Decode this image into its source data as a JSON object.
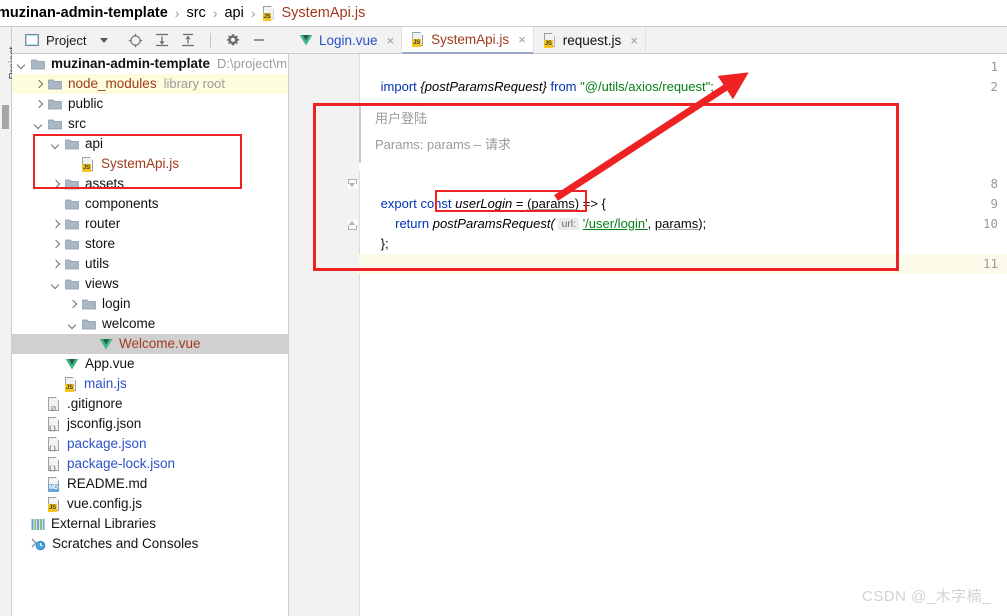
{
  "breadcrumb": {
    "segments": [
      {
        "text": "muzinan-admin-template",
        "kind": "root"
      },
      {
        "text": "src",
        "kind": "dir"
      },
      {
        "text": "api",
        "kind": "dir"
      },
      {
        "text": "SystemApi.js",
        "kind": "file-js"
      }
    ],
    "separator": "›"
  },
  "left_strip": {
    "vertical_tab_label": "Project"
  },
  "project_toolbar": {
    "title": "Project",
    "dropdown_caret": "chevron-down",
    "icons": [
      "locate-target-icon",
      "expand-all-icon",
      "collapse-all-icon",
      "settings-gear-icon",
      "hide-panel-icon"
    ]
  },
  "tree": {
    "items": [
      {
        "id": "root",
        "label": "muzinan-admin-template",
        "sub": "D:\\project\\m",
        "indent": 0,
        "arrow": "down",
        "icon": "folder-icon",
        "bold": true,
        "color": "dark",
        "highlight": false,
        "selected": false
      },
      {
        "id": "node_modules",
        "label": "node_modules",
        "sub": "library root",
        "indent": 1,
        "arrow": "right",
        "icon": "folder-icon",
        "bold": false,
        "color": "orange",
        "highlight": true,
        "selected": false
      },
      {
        "id": "public",
        "label": "public",
        "sub": "",
        "indent": 1,
        "arrow": "right",
        "icon": "folder-icon",
        "bold": false,
        "color": "dark",
        "highlight": false,
        "selected": false
      },
      {
        "id": "src",
        "label": "src",
        "sub": "",
        "indent": 1,
        "arrow": "down",
        "icon": "folder-icon",
        "bold": false,
        "color": "dark",
        "highlight": false,
        "selected": false
      },
      {
        "id": "api",
        "label": "api",
        "sub": "",
        "indent": 2,
        "arrow": "down",
        "icon": "folder-icon",
        "bold": false,
        "color": "dark",
        "highlight": false,
        "selected": false
      },
      {
        "id": "systemapi",
        "label": "SystemApi.js",
        "sub": "",
        "indent": 3,
        "arrow": "none",
        "icon": "js-file-icon",
        "bold": false,
        "color": "orange",
        "highlight": false,
        "selected": false
      },
      {
        "id": "assets",
        "label": "assets",
        "sub": "",
        "indent": 2,
        "arrow": "right",
        "icon": "folder-icon",
        "bold": false,
        "color": "dark",
        "highlight": false,
        "selected": false
      },
      {
        "id": "components",
        "label": "components",
        "sub": "",
        "indent": 2,
        "arrow": "none",
        "icon": "folder-icon",
        "bold": false,
        "color": "dark",
        "highlight": false,
        "selected": false
      },
      {
        "id": "router",
        "label": "router",
        "sub": "",
        "indent": 2,
        "arrow": "right",
        "icon": "folder-icon",
        "bold": false,
        "color": "dark",
        "highlight": false,
        "selected": false
      },
      {
        "id": "store",
        "label": "store",
        "sub": "",
        "indent": 2,
        "arrow": "right",
        "icon": "folder-icon",
        "bold": false,
        "color": "dark",
        "highlight": false,
        "selected": false
      },
      {
        "id": "utils",
        "label": "utils",
        "sub": "",
        "indent": 2,
        "arrow": "right",
        "icon": "folder-icon",
        "bold": false,
        "color": "dark",
        "highlight": false,
        "selected": false
      },
      {
        "id": "views",
        "label": "views",
        "sub": "",
        "indent": 2,
        "arrow": "down",
        "icon": "folder-icon",
        "bold": false,
        "color": "dark",
        "highlight": false,
        "selected": false
      },
      {
        "id": "login",
        "label": "login",
        "sub": "",
        "indent": 3,
        "arrow": "right",
        "icon": "folder-icon",
        "bold": false,
        "color": "dark",
        "highlight": false,
        "selected": false
      },
      {
        "id": "welcome",
        "label": "welcome",
        "sub": "",
        "indent": 3,
        "arrow": "down",
        "icon": "folder-icon",
        "bold": false,
        "color": "dark",
        "highlight": false,
        "selected": false
      },
      {
        "id": "welcomevue",
        "label": "Welcome.vue",
        "sub": "",
        "indent": 4,
        "arrow": "none",
        "icon": "vue-file-icon",
        "bold": false,
        "color": "orange",
        "highlight": false,
        "selected": true
      },
      {
        "id": "appvue",
        "label": "App.vue",
        "sub": "",
        "indent": 2,
        "arrow": "none",
        "icon": "vue-file-icon",
        "bold": false,
        "color": "dark",
        "highlight": false,
        "selected": false
      },
      {
        "id": "mainjs",
        "label": "main.js",
        "sub": "",
        "indent": 2,
        "arrow": "none",
        "icon": "js-file-icon",
        "bold": false,
        "color": "blue",
        "highlight": false,
        "selected": false
      },
      {
        "id": "gitignore",
        "label": ".gitignore",
        "sub": "",
        "indent": 1,
        "arrow": "none",
        "icon": "gitignore-file-icon",
        "bold": false,
        "color": "dark",
        "highlight": false,
        "selected": false
      },
      {
        "id": "jsconfig",
        "label": "jsconfig.json",
        "sub": "",
        "indent": 1,
        "arrow": "none",
        "icon": "json-file-icon",
        "bold": false,
        "color": "dark",
        "highlight": false,
        "selected": false
      },
      {
        "id": "packagejson",
        "label": "package.json",
        "sub": "",
        "indent": 1,
        "arrow": "none",
        "icon": "json-file-icon",
        "bold": false,
        "color": "blue",
        "highlight": false,
        "selected": false
      },
      {
        "id": "packagelock",
        "label": "package-lock.json",
        "sub": "",
        "indent": 1,
        "arrow": "none",
        "icon": "json-file-icon",
        "bold": false,
        "color": "blue",
        "highlight": false,
        "selected": false
      },
      {
        "id": "readme",
        "label": "README.md",
        "sub": "",
        "indent": 1,
        "arrow": "none",
        "icon": "md-file-icon",
        "bold": false,
        "color": "dark",
        "highlight": false,
        "selected": false
      },
      {
        "id": "vueconfig",
        "label": "vue.config.js",
        "sub": "",
        "indent": 1,
        "arrow": "none",
        "icon": "js-file-icon",
        "bold": false,
        "color": "dark",
        "highlight": false,
        "selected": false
      },
      {
        "id": "extlibs",
        "label": "External Libraries",
        "sub": "",
        "indent": 0,
        "arrow": "none",
        "icon": "external-libraries-icon",
        "bold": false,
        "color": "dark",
        "highlight": false,
        "selected": false
      },
      {
        "id": "scratches",
        "label": "Scratches and Consoles",
        "sub": "",
        "indent": 0,
        "arrow": "none",
        "icon": "scratches-icon",
        "bold": false,
        "color": "dark",
        "highlight": false,
        "selected": false
      }
    ]
  },
  "editor_tabs": [
    {
      "label": "Login.vue",
      "icon": "vue-file-icon",
      "color": "tab-vue",
      "active": false,
      "close": "×"
    },
    {
      "label": "SystemApi.js",
      "icon": "js-file-icon",
      "color": "tab-js",
      "active": true,
      "close": "×"
    },
    {
      "label": "request.js",
      "icon": "js-file-icon",
      "color": "tab-js2",
      "active": false,
      "close": "×"
    }
  ],
  "editor": {
    "line_numbers": [
      "1",
      "2",
      "8",
      "9",
      "10",
      "11"
    ],
    "current_line": "11",
    "folded_doc": {
      "line1": "用户登陆",
      "line2": "Params: params – 请求"
    },
    "code": {
      "line1": {
        "import_kw": "import",
        "braces": "{postParamsRequest}",
        "from_kw": "from",
        "module": "\"@/utils/axios/request\";"
      },
      "line8": {
        "export_kw": "export",
        "const_kw": "const",
        "name": "userLogin",
        "eq": "=",
        "params": "(params)",
        "arrow": "=> {"
      },
      "line9": {
        "return_kw": "return",
        "fn": "postParamsRequest(",
        "hint": "url:",
        "url": "'/user/login'",
        "comma": ",",
        "arg": "params",
        "tail": ");"
      },
      "line10": {
        "text": "};"
      }
    }
  },
  "annotations": {
    "accent_color": "#ee2222",
    "rect_tree": {
      "label": "api-folder-highlight"
    },
    "rect_code": {
      "label": "code-block-highlight"
    },
    "rect_fn": {
      "label": "postParamsRequest-highlight"
    },
    "arrow": {
      "label": "arrow-to-request-module"
    }
  },
  "watermark": {
    "text": "CSDN @_木字楠_"
  }
}
